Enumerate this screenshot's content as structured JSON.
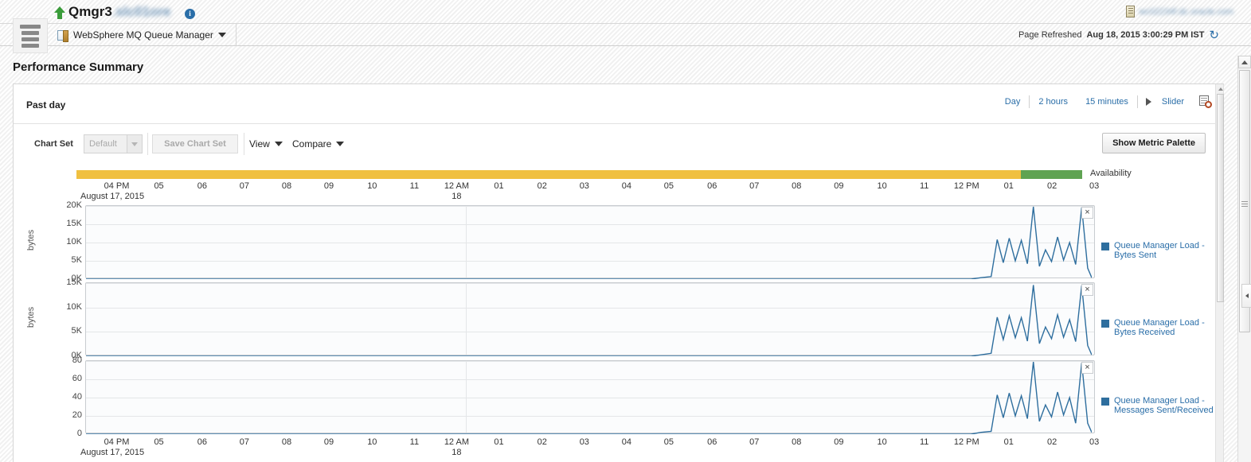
{
  "header": {
    "menu_icon": "hamburger-menu-icon",
    "status_icon": "up-arrow-icon",
    "target_name": "Qmgr3",
    "target_host_suffix": ".slc01ore",
    "info_icon": "i",
    "right_host": "wc02234f.dc.oracle.com",
    "context_label": "WebSphere MQ Queue Manager",
    "refresh_prefix": "Page Refreshed",
    "refresh_time": "Aug 18, 2015 3:00:29 PM IST",
    "refresh_icon": "↻"
  },
  "page": {
    "title": "Performance Summary"
  },
  "range": {
    "current_label": "Past day",
    "links": [
      "Day",
      "2 hours",
      "15 minutes"
    ],
    "slider_label": "Slider",
    "calendar_icon": "calendar-clock-icon"
  },
  "toolbar": {
    "chart_set_label": "Chart Set",
    "chart_set_value": "Default",
    "save_label": "Save Chart Set",
    "view_label": "View",
    "compare_label": "Compare",
    "show_palette_label": "Show Metric Palette"
  },
  "availability": {
    "label": "Availability",
    "segments": [
      {
        "status": "warning",
        "color": "#f0c040",
        "pct": 93.9
      },
      {
        "status": "up",
        "color": "#5fa352",
        "pct": 6.1
      }
    ]
  },
  "axis": {
    "date_label": "August 17, 2015",
    "ticks": [
      {
        "label": "04 PM",
        "sub": "",
        "pos": 4.0
      },
      {
        "label": "05",
        "sub": "",
        "pos": 8.2
      },
      {
        "label": "06",
        "sub": "",
        "pos": 12.5
      },
      {
        "label": "07",
        "sub": "",
        "pos": 16.7
      },
      {
        "label": "08",
        "sub": "",
        "pos": 20.9
      },
      {
        "label": "09",
        "sub": "",
        "pos": 25.1
      },
      {
        "label": "10",
        "sub": "",
        "pos": 29.4
      },
      {
        "label": "11",
        "sub": "",
        "pos": 33.6
      },
      {
        "label": "12 AM",
        "sub": "18",
        "pos": 37.8
      },
      {
        "label": "01",
        "sub": "",
        "pos": 42.0
      },
      {
        "label": "02",
        "sub": "",
        "pos": 46.3
      },
      {
        "label": "03",
        "sub": "",
        "pos": 50.5
      },
      {
        "label": "04",
        "sub": "",
        "pos": 54.7
      },
      {
        "label": "05",
        "sub": "",
        "pos": 58.9
      },
      {
        "label": "06",
        "sub": "",
        "pos": 63.2
      },
      {
        "label": "07",
        "sub": "",
        "pos": 67.4
      },
      {
        "label": "08",
        "sub": "",
        "pos": 71.6
      },
      {
        "label": "09",
        "sub": "",
        "pos": 75.8
      },
      {
        "label": "10",
        "sub": "",
        "pos": 80.1
      },
      {
        "label": "11",
        "sub": "",
        "pos": 84.3
      },
      {
        "label": "12 PM",
        "sub": "",
        "pos": 88.5
      },
      {
        "label": "01",
        "sub": "",
        "pos": 92.7
      },
      {
        "label": "02",
        "sub": "",
        "pos": 97.0
      },
      {
        "label": "03",
        "sub": "",
        "pos": 101.2
      }
    ]
  },
  "chart_data": [
    {
      "type": "line",
      "title": "Queue Manager Load - Bytes Sent",
      "legend_label": "Queue Manager Load - Bytes Sent",
      "ylabel": "bytes",
      "xlabel": "",
      "ylim": [
        0,
        20000
      ],
      "yticks": [
        0,
        5000,
        10000,
        15000,
        20000
      ],
      "ytick_labels": [
        "0K",
        "5K",
        "10K",
        "15K",
        "20K"
      ],
      "grid": true,
      "legend_position": "right",
      "color": "#2e6e9e",
      "x": [
        0,
        86,
        88,
        89,
        90,
        90.6,
        91.2,
        91.8,
        92.4,
        93,
        93.6,
        94.2,
        94.8,
        95.4,
        96,
        96.6,
        97.2,
        97.8,
        98.4,
        99,
        99.6,
        100.2
      ],
      "values": [
        0,
        0,
        0,
        400,
        700,
        10800,
        4500,
        11200,
        5000,
        10600,
        4200,
        19800,
        3500,
        8000,
        4800,
        11500,
        5200,
        10000,
        4000,
        19600,
        3000,
        400
      ]
    },
    {
      "type": "line",
      "title": "Queue Manager Load - Bytes Received",
      "legend_label": "Queue Manager Load - Bytes Received",
      "ylabel": "bytes",
      "xlabel": "",
      "ylim": [
        0,
        15000
      ],
      "yticks": [
        0,
        5000,
        10000,
        15000
      ],
      "ytick_labels": [
        "0K",
        "5K",
        "10K",
        "15K"
      ],
      "grid": true,
      "legend_position": "right",
      "color": "#2e6e9e",
      "x": [
        0,
        86,
        88,
        89,
        90,
        90.6,
        91.2,
        91.8,
        92.4,
        93,
        93.6,
        94.2,
        94.8,
        95.4,
        96,
        96.6,
        97.2,
        97.8,
        98.4,
        99,
        99.6,
        100.2
      ],
      "values": [
        0,
        0,
        0,
        300,
        600,
        8000,
        3400,
        8300,
        3800,
        7900,
        3100,
        14600,
        2600,
        6000,
        3600,
        8500,
        3900,
        7500,
        3000,
        14500,
        2200,
        300
      ]
    },
    {
      "type": "line",
      "title": "Queue Manager Load - Messages Sent/Received",
      "legend_label": "Queue Manager Load - Messages Sent/Received",
      "ylabel": "",
      "xlabel": "",
      "ylim": [
        0,
        80
      ],
      "yticks": [
        0,
        20,
        40,
        60,
        80
      ],
      "ytick_labels": [
        "0",
        "20",
        "40",
        "60",
        "80"
      ],
      "grid": true,
      "legend_position": "right",
      "color": "#2e6e9e",
      "x": [
        0,
        86,
        88,
        89,
        90,
        90.6,
        91.2,
        91.8,
        92.4,
        93,
        93.6,
        94.2,
        94.8,
        95.4,
        96,
        96.6,
        97.2,
        97.8,
        98.4,
        99,
        99.6,
        100.2
      ],
      "values": [
        0,
        0,
        0,
        2,
        3,
        43,
        18,
        45,
        20,
        42,
        17,
        79,
        14,
        32,
        19,
        46,
        21,
        40,
        12,
        78,
        12,
        2
      ]
    }
  ],
  "close_icon": "×"
}
